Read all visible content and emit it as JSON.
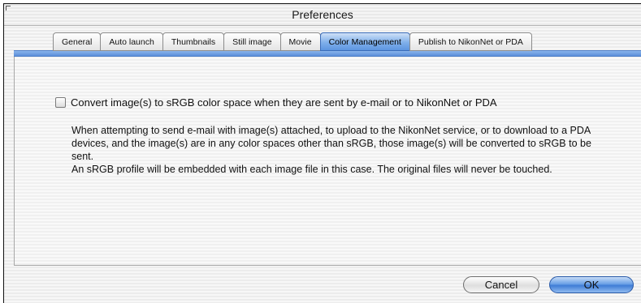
{
  "window": {
    "title": "Preferences"
  },
  "tabs": [
    {
      "label": "General",
      "active": false
    },
    {
      "label": "Auto launch",
      "active": false
    },
    {
      "label": "Thumbnails",
      "active": false
    },
    {
      "label": "Still image",
      "active": false
    },
    {
      "label": "Movie",
      "active": false
    },
    {
      "label": "Color Management",
      "active": true
    },
    {
      "label": "Publish to NikonNet or PDA",
      "active": false
    }
  ],
  "color_management": {
    "convert_checkbox": {
      "label": "Convert image(s) to sRGB color space when they are sent by e-mail or to NikonNet or PDA",
      "checked": false
    },
    "description_1": "When attempting to send e-mail with image(s) attached, to upload to the NikonNet service, or to download to a PDA devices, and the image(s) are in any color spaces other than sRGB, those image(s) will be converted to sRGB to be sent.",
    "description_2": "An sRGB profile will be embedded with each image file in this case. The original files will never be touched."
  },
  "buttons": {
    "cancel_label": "Cancel",
    "ok_label": "OK"
  },
  "colors": {
    "accent": "#5b8fd9",
    "active_tab": "#7fafea"
  }
}
